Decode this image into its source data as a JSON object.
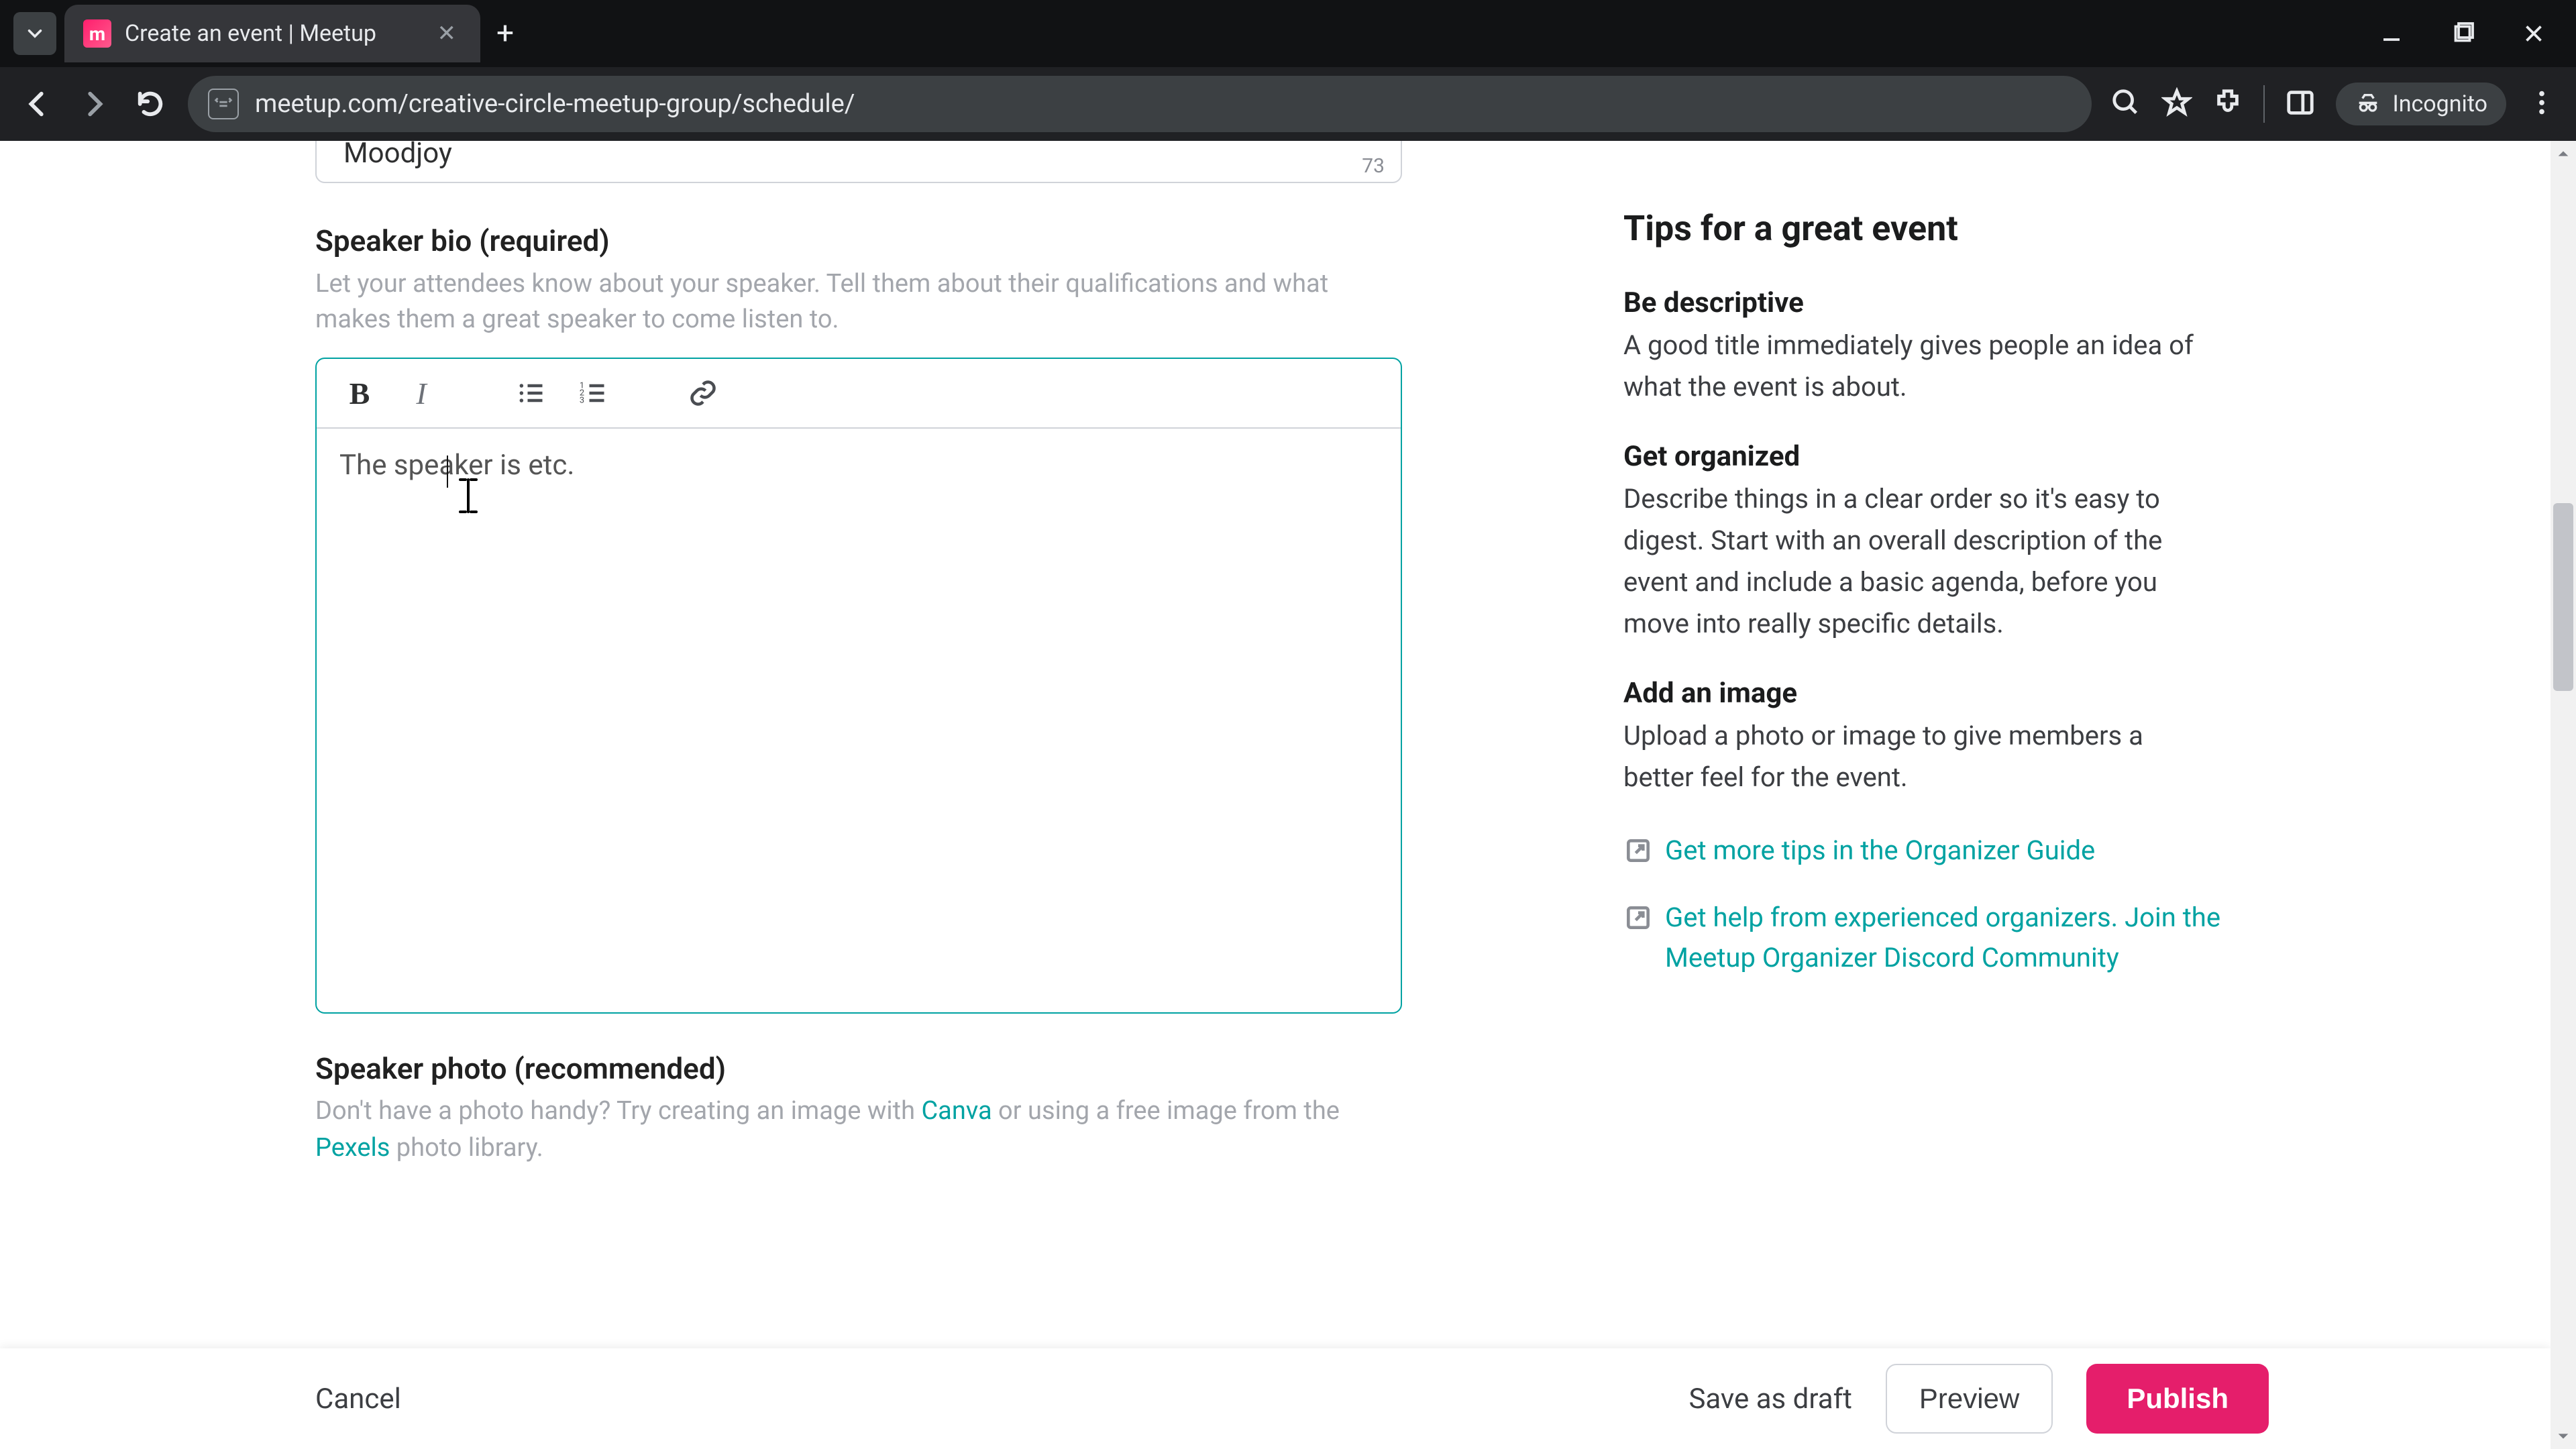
{
  "browser": {
    "tab_title": "Create an event | Meetup",
    "url": "meetup.com/creative-circle-meetup-group/schedule/",
    "incognito_label": "Incognito"
  },
  "prev_field": {
    "value": "Moodjoy",
    "char_count": "73"
  },
  "speaker_bio": {
    "label": "Speaker bio (required)",
    "hint": "Let your attendees know about your speaker. Tell them about their qualifications and what makes them a great speaker to come listen to.",
    "content": "The speaker is etc."
  },
  "speaker_photo": {
    "label": "Speaker photo (recommended)",
    "hint_pre": "Don't have a photo handy? Try creating an image with ",
    "canva": "Canva",
    "hint_mid": " or using a free image from the ",
    "pexels": "Pexels",
    "hint_post": " photo library."
  },
  "tips": {
    "title": "Tips for a great event",
    "t1_h": "Be descriptive",
    "t1_p": "A good title immediately gives people an idea of what the event is about.",
    "t2_h": "Get organized",
    "t2_p": "Describe things in a clear order so it's easy to digest. Start with an overall description of the event and include a basic agenda, before you move into really specific details.",
    "t3_h": "Add an image",
    "t3_p": "Upload a photo or image to give members a better feel for the event.",
    "link1": "Get more tips in the Organizer Guide",
    "link2": "Get help from experienced organizers. Join the Meetup Organizer Discord Community"
  },
  "footer": {
    "cancel": "Cancel",
    "save_draft": "Save as draft",
    "preview": "Preview",
    "publish": "Publish"
  }
}
